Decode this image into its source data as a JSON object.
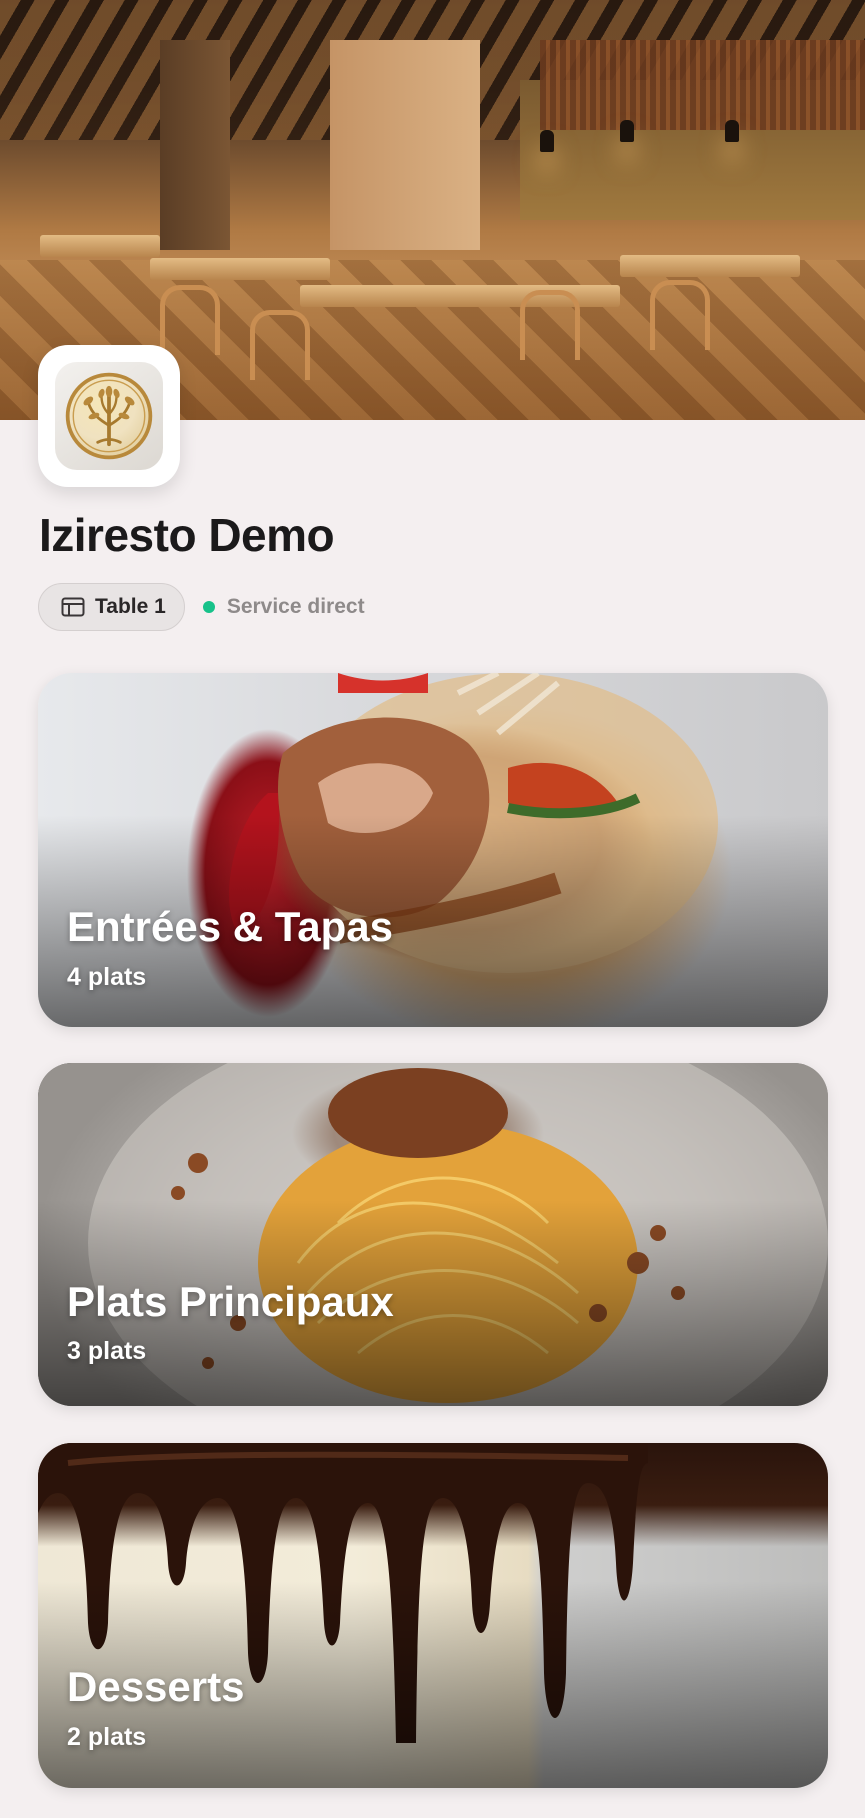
{
  "restaurant": {
    "name": "Iziresto Demo"
  },
  "header": {
    "hero_image": "restaurant-dining-room-photo",
    "logo_icon": "golden-tree-emblem-icon"
  },
  "table_chip": {
    "icon": "table-icon",
    "label": "Table 1"
  },
  "service_status": {
    "label": "Service direct",
    "dot_color": "#17c28a"
  },
  "categories": [
    {
      "name": "Entrées & Tapas",
      "count": "4 plats",
      "image": "grilled-meat-plate-photo"
    },
    {
      "name": "Plats Principaux",
      "count": "3 plats",
      "image": "spaghetti-bolognese-photo"
    },
    {
      "name": "Desserts",
      "count": "2 plats",
      "image": "chocolate-drip-cake-photo"
    }
  ],
  "colors": {
    "background": "#f4eff0",
    "status_green": "#17c28a",
    "logo_gold": "#b8893b"
  }
}
